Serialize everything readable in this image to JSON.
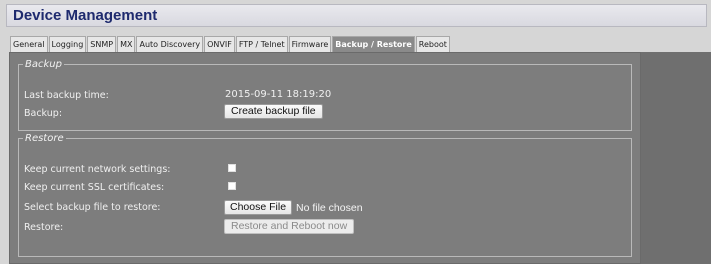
{
  "header": {
    "title": "Device Management"
  },
  "tabs": [
    {
      "label": "General",
      "active": false
    },
    {
      "label": "Logging",
      "active": false
    },
    {
      "label": "SNMP",
      "active": false
    },
    {
      "label": "MX",
      "active": false
    },
    {
      "label": "Auto Discovery",
      "active": false
    },
    {
      "label": "ONVIF",
      "active": false
    },
    {
      "label": "FTP / Telnet",
      "active": false
    },
    {
      "label": "Firmware",
      "active": false
    },
    {
      "label": "Backup / Restore",
      "active": true
    },
    {
      "label": "Reboot",
      "active": false
    }
  ],
  "backup": {
    "legend": "Backup",
    "last_backup_label": "Last backup time:",
    "last_backup_value": "2015-09-11 18:19:20",
    "backup_label": "Backup:",
    "create_button": "Create backup file"
  },
  "restore": {
    "legend": "Restore",
    "keep_network_label": "Keep current network settings:",
    "keep_network_checked": false,
    "keep_ssl_label": "Keep current SSL certificates:",
    "keep_ssl_checked": false,
    "select_file_label": "Select backup file to restore:",
    "choose_file_button": "Choose File",
    "no_file_text": "No file chosen",
    "restore_label": "Restore:",
    "restore_button": "Restore and Reboot now"
  },
  "colors": {
    "title": "#1e2a6e",
    "panel_bg": "#7d7d7d",
    "active_tab_bg": "#8a8a8a"
  }
}
